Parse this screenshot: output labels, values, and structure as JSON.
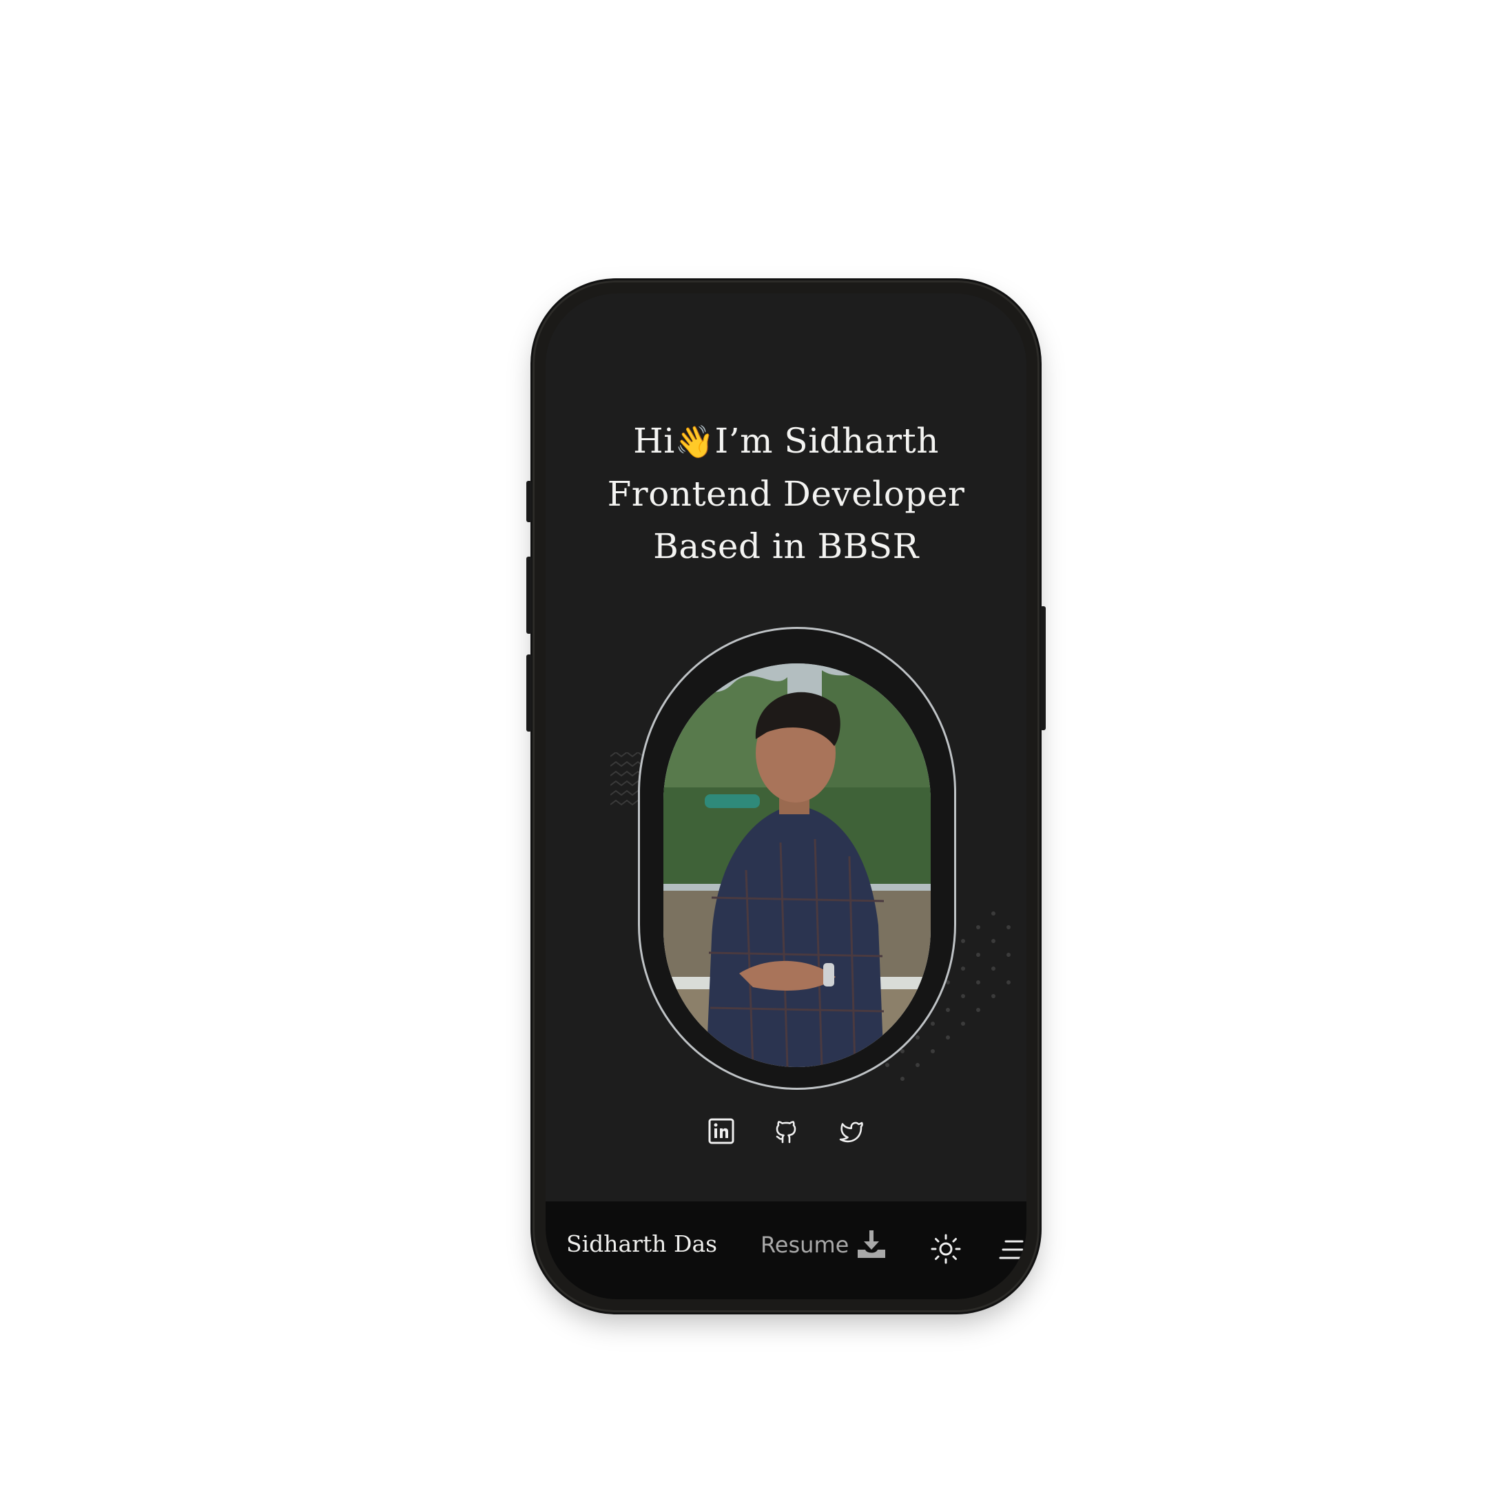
{
  "hero": {
    "greeting_before": "Hi",
    "wave_emoji": "👋",
    "greeting_after": "I’m Sidharth",
    "line2": "Frontend Developer",
    "line3": "Based in BBSR"
  },
  "socials": [
    {
      "icon": "linkedin-icon"
    },
    {
      "icon": "github-icon"
    },
    {
      "icon": "twitter-icon"
    }
  ],
  "navbar": {
    "brand": "Sidharth Das",
    "resume_label": "Resume",
    "resume_icon": "download-icon",
    "theme_icon": "sun-icon",
    "menu_icon": "menu-icon"
  },
  "colors": {
    "screen_bg": "#1d1d1d",
    "navbar_bg": "#0c0c0c",
    "text": "#f4f4f2",
    "muted": "#a9a9a9",
    "ring": "#bfc3c6"
  }
}
